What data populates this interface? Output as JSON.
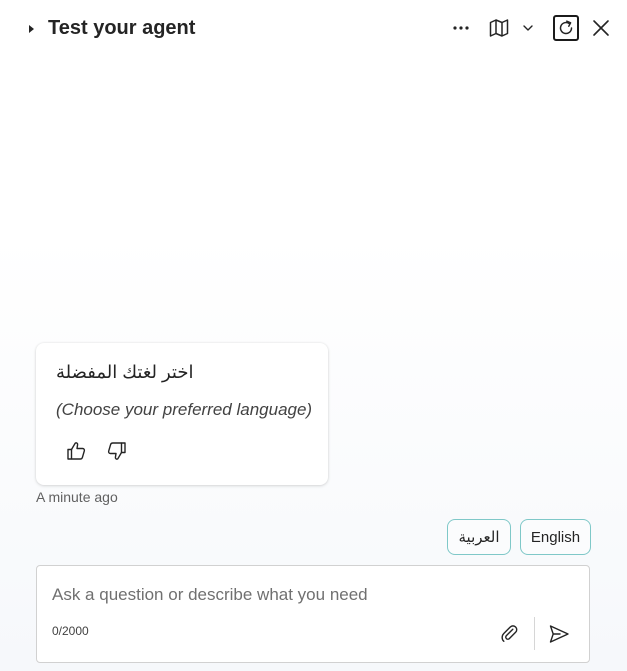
{
  "header": {
    "title": "Test your agent",
    "icons": [
      "caret-right-icon",
      "more-icon",
      "map-icon",
      "chevron-down-icon",
      "refresh-icon",
      "close-icon"
    ]
  },
  "message": {
    "arabic_text": "اختر لغتك المفضلة",
    "english_text": "(Choose your preferred language)",
    "timestamp": "A minute ago",
    "reaction_icons": [
      "thumbs-up-icon",
      "thumbs-down-icon"
    ]
  },
  "suggestions": [
    {
      "label": "العربية"
    },
    {
      "label": "English"
    }
  ],
  "composer": {
    "placeholder": "Ask a question or describe what you need",
    "value": "",
    "char_count": "0/2000",
    "icons": [
      "attach-icon",
      "send-icon"
    ]
  },
  "colors": {
    "chip_border": "#7fc8c8",
    "text_primary": "#242424",
    "text_secondary": "#616161"
  }
}
